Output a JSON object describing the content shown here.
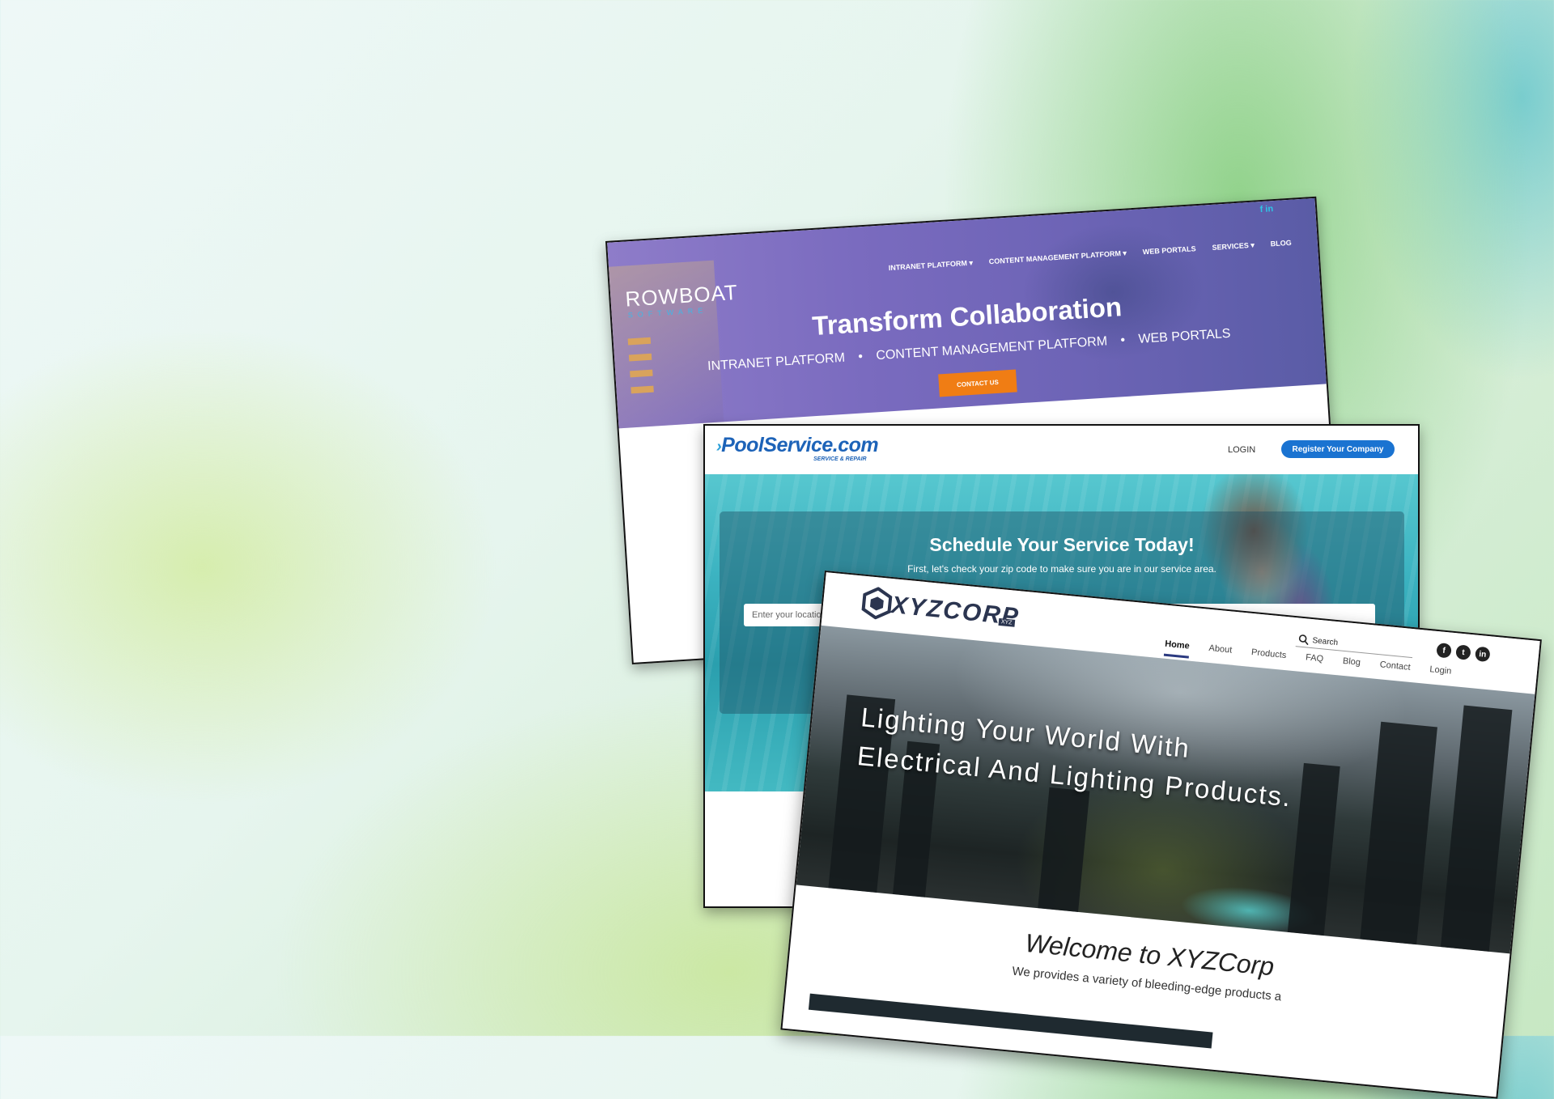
{
  "rowboat": {
    "logo": "ROWBOAT",
    "logo_sub": "SOFTWARE",
    "social": [
      "f",
      "in"
    ],
    "nav": [
      "INTRANET PLATFORM ▾",
      "CONTENT MANAGEMENT PLATFORM ▾",
      "WEB PORTALS",
      "SERVICES ▾",
      "BLOG"
    ],
    "title": "Transform Collaboration",
    "subtitle_items": [
      "INTRANET PLATFORM",
      "CONTENT MANAGEMENT PLATFORM",
      "WEB PORTALS"
    ],
    "separator": "•",
    "cta": "CONTACT US"
  },
  "pool": {
    "logo": "PoolService.com",
    "logo_sub": "SERVICE & REPAIR",
    "login": "LOGIN",
    "register": "Register Your Company",
    "hero_title": "Schedule Your Service Today!",
    "hero_text": "First, let's check your zip code to make sure you are in our service area.",
    "zip_placeholder": "Enter your location"
  },
  "xyz": {
    "logo": "XYZCORP",
    "logo_tag": "XYZ",
    "search_placeholder": "Search",
    "socials": [
      "f",
      "t",
      "in"
    ],
    "nav": [
      "Home",
      "About",
      "Products",
      "FAQ",
      "Blog",
      "Contact",
      "Login"
    ],
    "hero_line1": "Lighting Your World With",
    "hero_line2": "Electrical And Lighting Products.",
    "welcome": "Welcome to XYZCorp",
    "tagline": "We provides a variety of bleeding-edge products a"
  }
}
